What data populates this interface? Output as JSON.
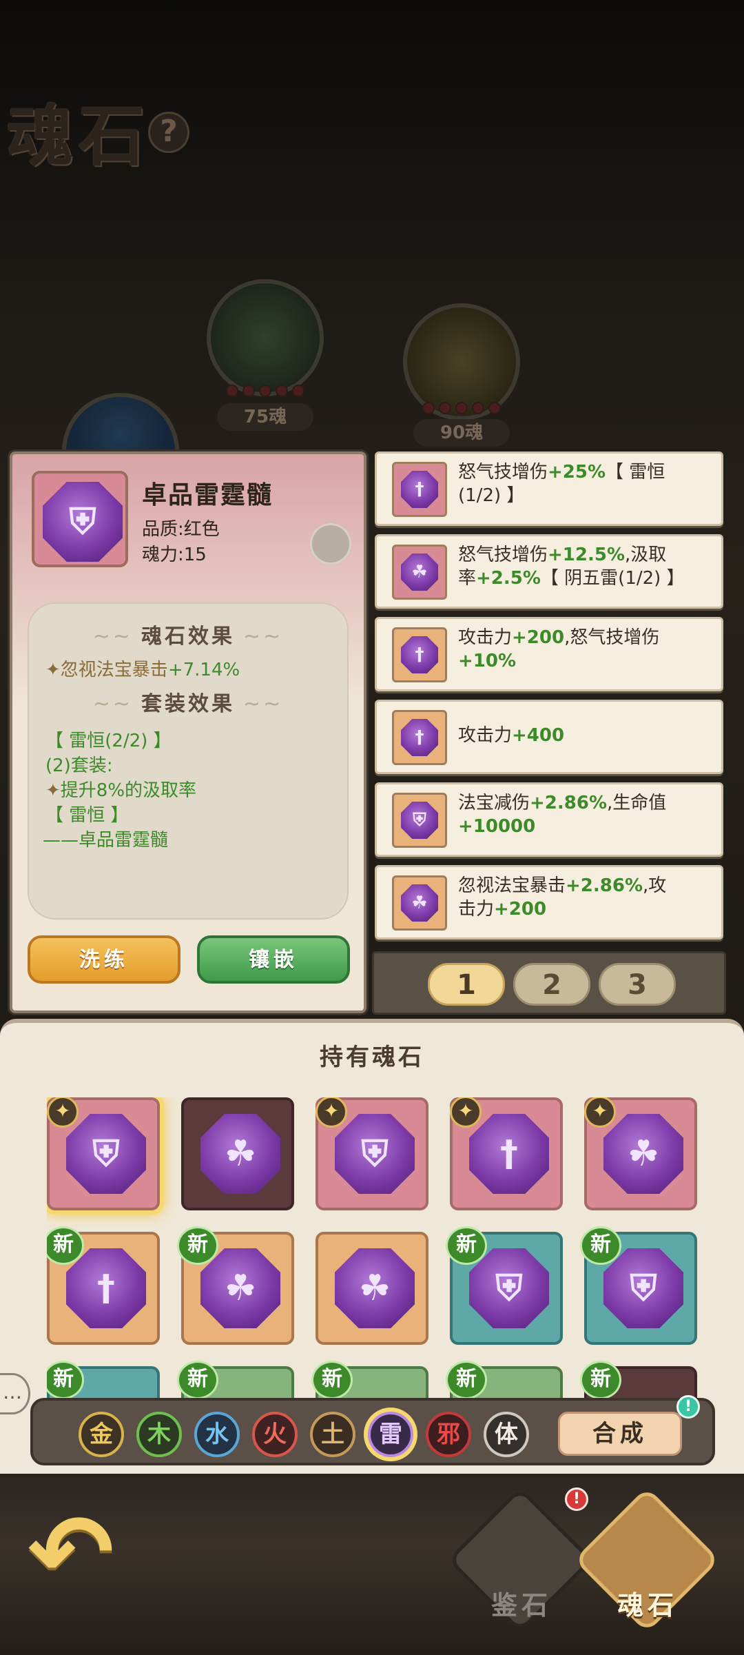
{
  "page": {
    "title": "魂石",
    "help_icon": "?"
  },
  "orbs": [
    {
      "cost": "75魂"
    },
    {
      "cost": "90魂"
    }
  ],
  "detail": {
    "name": "卓品雷霆髓",
    "quality": "品质:红色",
    "soul_power": "魂力:15",
    "effect_heading": "魂石效果",
    "effect_prefix": "忽视法宝暴击",
    "effect_value": "+7.14%",
    "set_heading": "套装效果",
    "set_name": "【 雷恒(2/2) 】",
    "set_count": "(2)套装:",
    "set_bonus": "提升8%的汲取率",
    "set_name2": "【 雷恒 】",
    "set_member": "——卓品雷霆髓",
    "refine_label": "洗练",
    "inlay_label": "镶嵌"
  },
  "stone_list": [
    {
      "a": "怒气技增伤",
      "b": "+25%",
      "c": "【 雷恒",
      "d": "(1/2) 】",
      "e": "",
      "f": "",
      "symbol": "†",
      "bg": "#d98b95"
    },
    {
      "a": "怒气技增伤",
      "b": "+12.5%",
      "c": ",汲取",
      "d": "率",
      "e": "+2.5%",
      "f": "【 阴五雷(1/2) 】",
      "symbol": "☘",
      "bg": "#d98b95"
    },
    {
      "a": "攻击力",
      "b": "+200",
      "c": ",怒气技增伤",
      "d": "",
      "e": "+10%",
      "f": "",
      "symbol": "†",
      "bg": "#e9b27a"
    },
    {
      "a": "攻击力",
      "b": "+400",
      "c": "",
      "d": "",
      "e": "",
      "f": "",
      "symbol": "†",
      "bg": "#e9b27a"
    },
    {
      "a": "法宝减伤",
      "b": "+2.86%",
      "c": ",生命值",
      "d": "",
      "e": "+10000",
      "f": "",
      "symbol": "⛨",
      "bg": "#e9b27a"
    },
    {
      "a": "忽视法宝暴击",
      "b": "+2.86%",
      "c": ",攻",
      "d": "击力",
      "e": "+200",
      "f": "",
      "symbol": "☘",
      "bg": "#e9b27a"
    }
  ],
  "pages": [
    "1",
    "2",
    "3"
  ],
  "inventory": {
    "title": "持有魂石",
    "star_glyph": "✦",
    "new_label": "新",
    "slots": [
      {
        "color": "red",
        "symbol": "⛨",
        "badge": "star",
        "selected": true
      },
      {
        "color": "dark",
        "symbol": "☘",
        "badge": ""
      },
      {
        "color": "red",
        "symbol": "⛨",
        "badge": "star"
      },
      {
        "color": "red",
        "symbol": "†",
        "badge": "star"
      },
      {
        "color": "red",
        "symbol": "☘",
        "badge": "star"
      },
      {
        "color": "orange",
        "symbol": "†",
        "badge": "new"
      },
      {
        "color": "orange",
        "symbol": "☘",
        "badge": "new"
      },
      {
        "color": "orange",
        "symbol": "☘",
        "badge": ""
      },
      {
        "color": "teal",
        "symbol": "⛨",
        "badge": "new"
      },
      {
        "color": "teal",
        "symbol": "⛨",
        "badge": "new"
      },
      {
        "color": "teal",
        "symbol": "",
        "badge": "new"
      },
      {
        "color": "green-bg",
        "symbol": "",
        "badge": "new"
      },
      {
        "color": "green-bg",
        "symbol": "",
        "badge": "new"
      },
      {
        "color": "green-bg",
        "symbol": "",
        "badge": "new"
      },
      {
        "color": "dark",
        "symbol": "",
        "badge": "new"
      }
    ]
  },
  "elements": [
    {
      "label": "金",
      "ring": "#d8b24a",
      "fill": "#3d3226",
      "text": "#f0c95a"
    },
    {
      "label": "木",
      "ring": "#6fbf4e",
      "fill": "#2c3a23",
      "text": "#7fd35c"
    },
    {
      "label": "水",
      "ring": "#5aa6d6",
      "fill": "#233244",
      "text": "#79c3f0"
    },
    {
      "label": "火",
      "ring": "#d8564a",
      "fill": "#3e2322",
      "text": "#f06a5c"
    },
    {
      "label": "土",
      "ring": "#c49a5a",
      "fill": "#3a2e22",
      "text": "#e0b678"
    },
    {
      "label": "雷",
      "ring": "#b98ae0",
      "fill": "#3a2a4a",
      "text": "#e2c8ff",
      "selected": true
    },
    {
      "label": "邪",
      "ring": "#c23a3a",
      "fill": "#3d1d1d",
      "text": "#e84a4a"
    },
    {
      "label": "体",
      "ring": "#cfc8c0",
      "fill": "#33302d",
      "text": "#f0ebe4"
    }
  ],
  "combine_label": "合成",
  "nav": {
    "appraise_label": "鉴石",
    "soulstone_label": "魂石",
    "back_glyph": "↶",
    "alert_glyph": "!",
    "chat_glyph": "…"
  }
}
